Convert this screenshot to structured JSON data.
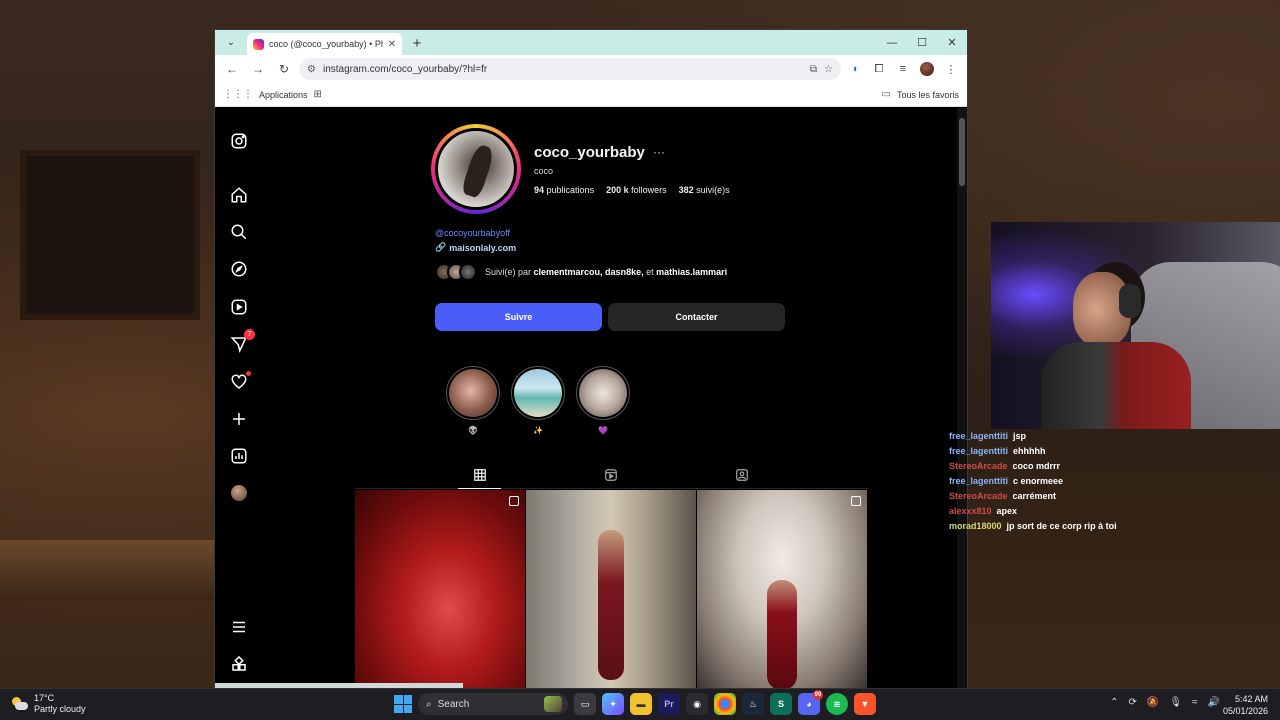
{
  "browser": {
    "tab_title": "coco (@coco_yourbaby) • Photos",
    "url": "instagram.com/coco_yourbaby/?hl=fr",
    "bookmarks": {
      "applications": "Applications",
      "all_favorites": "Tous les favoris"
    }
  },
  "profile": {
    "username": "coco_yourbaby",
    "more": "···",
    "full_name": "coco",
    "stats": {
      "posts_count": "94",
      "posts_label": "publications",
      "followers_count": "200 k",
      "followers_label": "followers",
      "following_count": "382",
      "following_label": "suivi(e)s"
    },
    "bio_handle": "@cocoyourbabyoff",
    "bio_link": "maisonlaly.com",
    "followed_by_prefix": "Suivi(e) par",
    "followed_by_names": "clementmarcou, dasn8ke,",
    "followed_by_and": "et",
    "followed_by_last": "mathias.lammari",
    "follow_button": "Suivre",
    "contact_button": "Contacter",
    "highlights": [
      {
        "label": "👽"
      },
      {
        "label": "✨"
      },
      {
        "label": "💜"
      }
    ]
  },
  "sidebar": {
    "notifications_badge": "7"
  },
  "chat": [
    {
      "user": "free_lagenttiti",
      "msg": "jsp",
      "color": "#8ab4f8"
    },
    {
      "user": "free_lagenttiti",
      "msg": "ehhhhh",
      "color": "#8ab4f8"
    },
    {
      "user": "StereoArcade",
      "msg": "coco mdrrr",
      "color": "#d04a4a"
    },
    {
      "user": "free_lagenttiti",
      "msg": "c enormeee",
      "color": "#8ab4f8"
    },
    {
      "user": "StereoArcade",
      "msg": "carrément",
      "color": "#d04a4a"
    },
    {
      "user": "alexxx810",
      "msg": "apex",
      "color": "#d04a4a"
    },
    {
      "user": "morad18000",
      "msg": "jp sort de ce corp rip à toi",
      "color": "#d6d67a"
    }
  ],
  "taskbar": {
    "temperature": "17°C",
    "weather": "Partly cloudy",
    "search_placeholder": "Search",
    "time": "5:42 AM",
    "date": "05/01/2026",
    "discord_badge": "99"
  }
}
